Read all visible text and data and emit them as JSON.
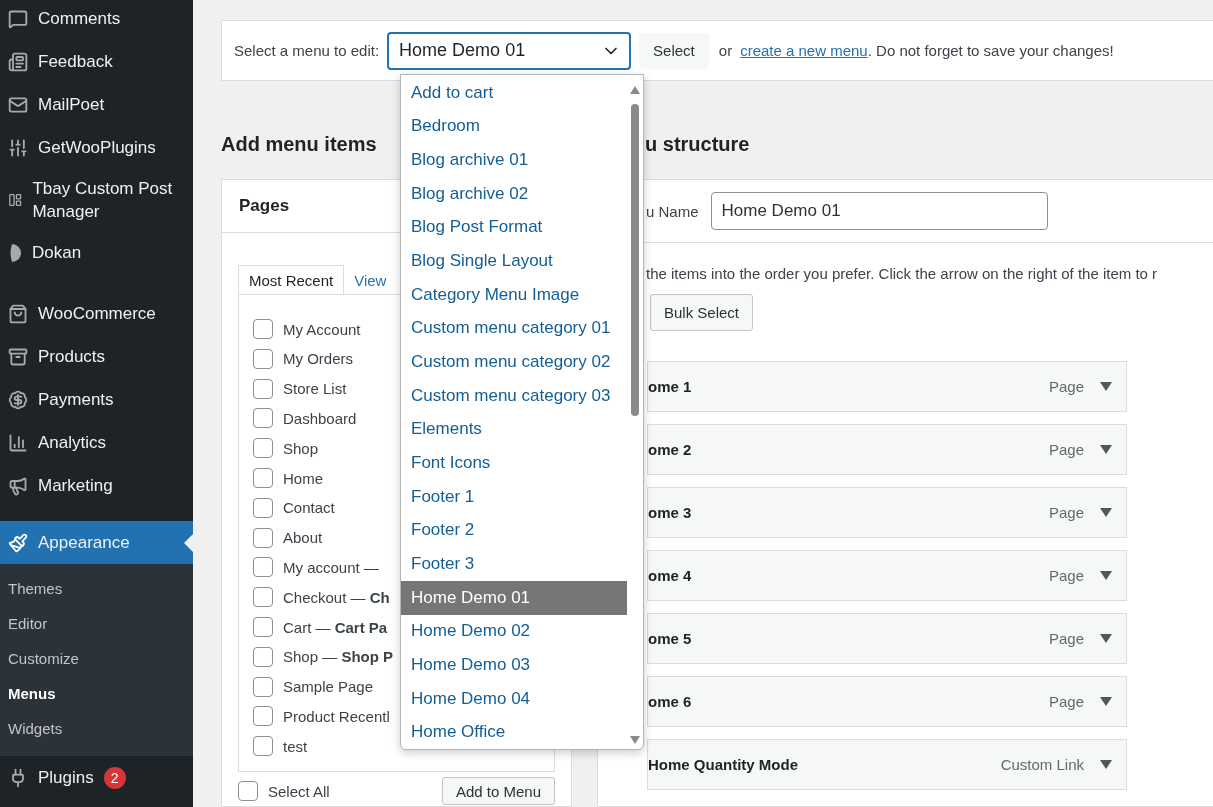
{
  "sidebar": {
    "items": [
      {
        "label": "Comments",
        "selected": false
      },
      {
        "label": "Feedback",
        "selected": false
      },
      {
        "label": "MailPoet",
        "selected": false
      },
      {
        "label": "GetWooPlugins",
        "selected": false
      },
      {
        "label": "Tbay Custom Post Manager",
        "selected": false
      },
      {
        "label": "Dokan",
        "selected": false
      },
      {
        "label": "WooCommerce",
        "selected": false
      },
      {
        "label": "Products",
        "selected": false
      },
      {
        "label": "Payments",
        "selected": false
      },
      {
        "label": "Analytics",
        "selected": false
      },
      {
        "label": "Marketing",
        "selected": false
      },
      {
        "label": "Appearance",
        "selected": true,
        "children": [
          {
            "label": "Themes",
            "selected": false
          },
          {
            "label": "Editor",
            "selected": false
          },
          {
            "label": "Customize",
            "selected": false
          },
          {
            "label": "Menus",
            "selected": true
          },
          {
            "label": "Widgets",
            "selected": false
          }
        ]
      },
      {
        "label": "Plugins",
        "selected": false,
        "badge": "2"
      }
    ]
  },
  "menu_select_bar": {
    "label": "Select a menu to edit:",
    "value": "Home Demo 01",
    "button": "Select",
    "note_prefix": "or",
    "link": "create a new menu",
    "note_suffix": ". Do not forget to save your changes!"
  },
  "dropdown": {
    "options": [
      {
        "label": "Add to cart",
        "selected": false
      },
      {
        "label": "Bedroom",
        "selected": false
      },
      {
        "label": "Blog archive 01",
        "selected": false
      },
      {
        "label": "Blog archive 02",
        "selected": false
      },
      {
        "label": "Blog Post Format",
        "selected": false
      },
      {
        "label": "Blog Single Layout",
        "selected": false
      },
      {
        "label": "Category Menu Image",
        "selected": false
      },
      {
        "label": "Custom menu category 01",
        "selected": false
      },
      {
        "label": "Custom menu category 02",
        "selected": false
      },
      {
        "label": "Custom menu category 03",
        "selected": false
      },
      {
        "label": "Elements",
        "selected": false
      },
      {
        "label": "Font Icons",
        "selected": false
      },
      {
        "label": "Footer 1",
        "selected": false
      },
      {
        "label": "Footer 2",
        "selected": false
      },
      {
        "label": "Footer 3",
        "selected": false
      },
      {
        "label": "Home Demo 01",
        "selected": true
      },
      {
        "label": "Home Demo 02",
        "selected": false
      },
      {
        "label": "Home Demo 03",
        "selected": false
      },
      {
        "label": "Home Demo 04",
        "selected": false
      },
      {
        "label": "Home Office",
        "selected": false
      }
    ]
  },
  "add_items": {
    "heading": "Add menu items",
    "panel_title": "Pages",
    "tabs": [
      {
        "label": "Most Recent",
        "selected": true
      },
      {
        "label": "View",
        "selected": false
      }
    ],
    "pages": [
      {
        "label": "My Account",
        "checked": false
      },
      {
        "label": "My Orders",
        "checked": false
      },
      {
        "label": "Store List",
        "checked": false
      },
      {
        "label": "Dashboard",
        "checked": false
      },
      {
        "label": "Shop",
        "checked": false
      },
      {
        "label": "Home",
        "checked": false
      },
      {
        "label": "Contact",
        "checked": false
      },
      {
        "label": "About",
        "checked": false
      },
      {
        "label": "My account —",
        "checked": false
      },
      {
        "label": "Checkout — **Ch**",
        "checked": false
      },
      {
        "label": "Cart — **Cart Pa**",
        "checked": false
      },
      {
        "label": "Shop — **Shop P**",
        "checked": false
      },
      {
        "label": "Sample Page",
        "checked": false
      },
      {
        "label": "Product Recentl",
        "checked": false
      },
      {
        "label": "test",
        "checked": false
      }
    ],
    "select_all": {
      "label": "Select All",
      "checked": false
    },
    "add_button": "Add to Menu"
  },
  "structure": {
    "heading": "u structure",
    "name_label": "u Name",
    "name_value": "Home Demo 01",
    "instructions": "the items into the order you prefer. Click the arrow on the right of the item to r",
    "bulk_button": "Bulk Select",
    "items": [
      {
        "title": "ome 1",
        "type": "Page"
      },
      {
        "title": "ome 2",
        "type": "Page"
      },
      {
        "title": "ome 3",
        "type": "Page"
      },
      {
        "title": "ome 4",
        "type": "Page"
      },
      {
        "title": "ome 5",
        "type": "Page"
      },
      {
        "title": "ome 6",
        "type": "Page"
      },
      {
        "title": "Home Quantity Mode",
        "type": "Custom Link"
      }
    ]
  }
}
